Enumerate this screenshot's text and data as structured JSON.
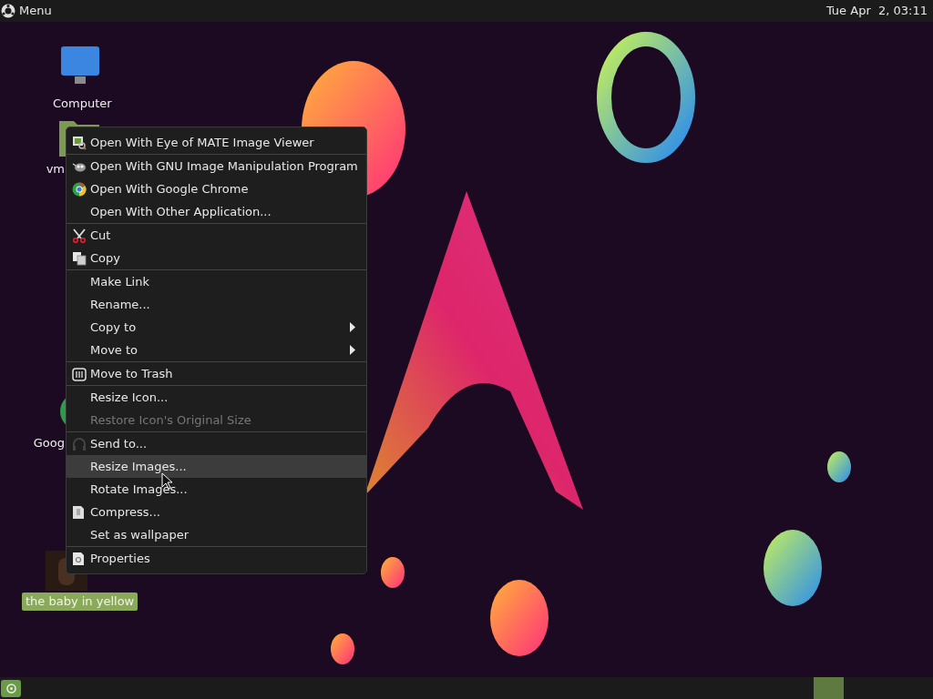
{
  "top_panel": {
    "menu_label": "Menu",
    "clock": "Tue Apr  2, 03:11"
  },
  "desktop_icons": [
    {
      "kind": "computer",
      "label": "Computer",
      "selected": false
    },
    {
      "kind": "folder",
      "label": "vm",
      "selected": false
    },
    {
      "kind": "chrome",
      "label": "Goog",
      "selected": false
    },
    {
      "label": "the baby in yellow",
      "selected": true
    }
  ],
  "context_menu": [
    {
      "kind": "item",
      "label": "Open With Eye of MATE Image Viewer",
      "disabled": false,
      "selected": false,
      "submenu": false
    },
    {
      "kind": "separator"
    },
    {
      "kind": "item",
      "label": "Open With GNU Image Manipulation Program",
      "disabled": false,
      "selected": false,
      "submenu": false
    },
    {
      "kind": "item",
      "label": "Open With Google Chrome",
      "disabled": false,
      "selected": false,
      "submenu": false
    },
    {
      "kind": "item",
      "label": "Open With Other Application...",
      "disabled": false,
      "selected": false,
      "submenu": false
    },
    {
      "kind": "separator"
    },
    {
      "kind": "item",
      "label": "Cut",
      "disabled": false,
      "selected": false,
      "submenu": false
    },
    {
      "kind": "item",
      "label": "Copy",
      "disabled": false,
      "selected": false,
      "submenu": false
    },
    {
      "kind": "separator"
    },
    {
      "kind": "item",
      "label": "Make Link",
      "disabled": false,
      "selected": false,
      "submenu": false
    },
    {
      "kind": "item",
      "label": "Rename...",
      "disabled": false,
      "selected": false,
      "submenu": false
    },
    {
      "kind": "item",
      "label": "Copy to",
      "disabled": false,
      "selected": false,
      "submenu": true
    },
    {
      "kind": "item",
      "label": "Move to",
      "disabled": false,
      "selected": false,
      "submenu": true
    },
    {
      "kind": "separator"
    },
    {
      "kind": "item",
      "label": "Move to Trash",
      "disabled": false,
      "selected": false,
      "submenu": false
    },
    {
      "kind": "separator"
    },
    {
      "kind": "item",
      "label": "Resize Icon...",
      "disabled": false,
      "selected": false,
      "submenu": false
    },
    {
      "kind": "item",
      "label": "Restore Icon's Original Size",
      "disabled": true,
      "selected": false,
      "submenu": false
    },
    {
      "kind": "separator"
    },
    {
      "kind": "item",
      "label": "Send to...",
      "disabled": false,
      "selected": false,
      "submenu": false
    },
    {
      "kind": "item",
      "label": "Resize Images...",
      "disabled": false,
      "selected": true,
      "submenu": false
    },
    {
      "kind": "item",
      "label": "Rotate Images...",
      "disabled": false,
      "selected": false,
      "submenu": false
    },
    {
      "kind": "item",
      "label": "Compress...",
      "disabled": false,
      "selected": false,
      "submenu": false
    },
    {
      "kind": "item",
      "label": "Set as wallpaper",
      "disabled": false,
      "selected": false,
      "submenu": false
    },
    {
      "kind": "separator"
    },
    {
      "kind": "item",
      "label": "Properties",
      "disabled": false,
      "selected": false,
      "submenu": false
    }
  ]
}
